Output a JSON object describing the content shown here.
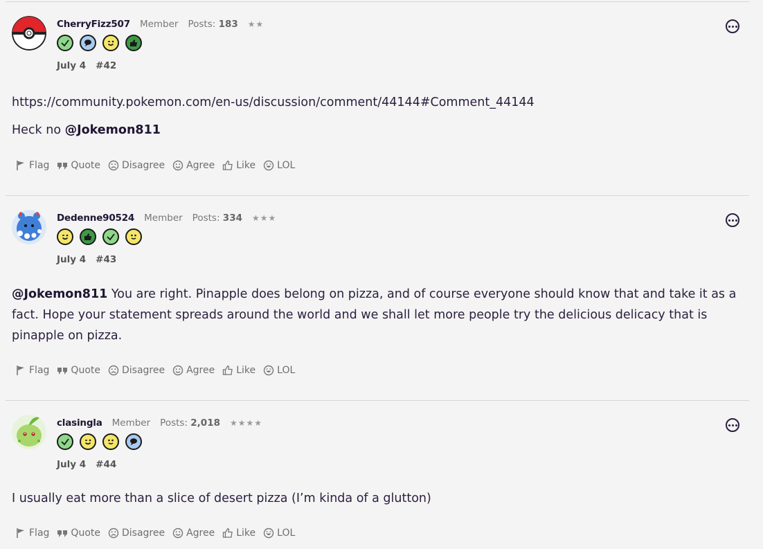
{
  "posts": [
    {
      "username": "CherryFizz507",
      "role": "Member",
      "posts_label": "Posts:",
      "posts_count": "183",
      "stars": "★★",
      "badges": [
        "check-badge",
        "comment-badge",
        "wink-badge",
        "thumbs-up-badge"
      ],
      "date": "July 4",
      "number": "#42",
      "paragraphs": [
        {
          "text": "https://community.pokemon.com/en-us/discussion/comment/44144#Comment_44144",
          "mention": ""
        },
        {
          "text": "Heck no ",
          "mention": "@Jokemon811"
        }
      ]
    },
    {
      "username": "Dedenne90524",
      "role": "Member",
      "posts_label": "Posts:",
      "posts_count": "334",
      "stars": "★★★",
      "badges": [
        "wink-badge",
        "thumbs-up-badge",
        "check-badge",
        "smile-badge"
      ],
      "date": "July 4",
      "number": "#43",
      "paragraphs": [
        {
          "mention": "@Jokemon811",
          "text": " You are right. Pinapple does belong on pizza, and of course everyone should know that and take it as a fact. Hope your statement spreads around the world and we shall let more people try the delicious delicacy that is pinapple on pizza."
        }
      ]
    },
    {
      "username": "clasingla",
      "role": "Member",
      "posts_label": "Posts:",
      "posts_count": "2,018",
      "stars": "★★★★",
      "badges": [
        "check-badge",
        "wink-badge",
        "smile-badge",
        "comment-badge"
      ],
      "date": "July 4",
      "number": "#44",
      "paragraphs": [
        {
          "text": "I usually eat more than a slice of desert pizza (I’m kinda of a glutton)",
          "mention": ""
        }
      ]
    }
  ],
  "actions": {
    "flag": "Flag",
    "quote": "Quote",
    "disagree": "Disagree",
    "agree": "Agree",
    "like": "Like",
    "lol": "LOL"
  },
  "colors": {
    "badge_green": "#8ed88a",
    "badge_blue": "#a9cbef",
    "badge_yellow": "#f5e66a",
    "badge_darkgreen": "#3d9a45",
    "text": "#2a1f3d"
  }
}
